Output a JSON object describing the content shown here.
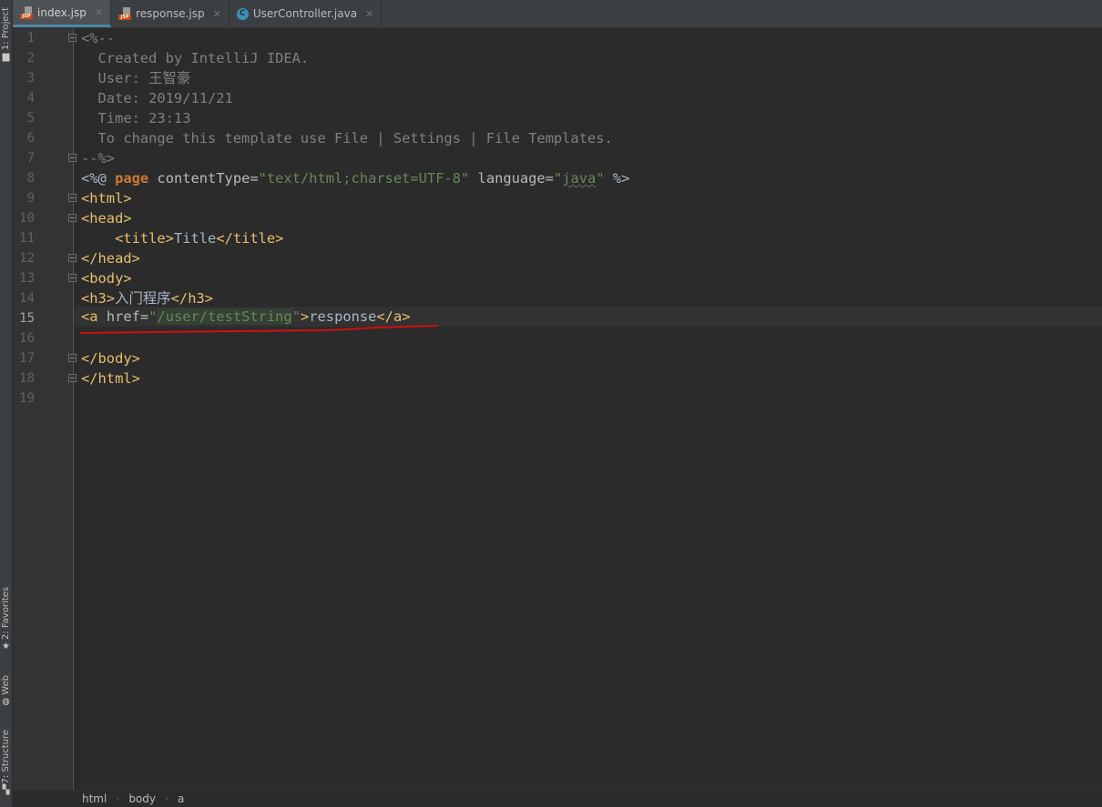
{
  "tool_windows": {
    "project": {
      "label": "1: Project",
      "icon": "folder-icon"
    },
    "favorites": {
      "label": "2: Favorites",
      "icon": "star-icon"
    },
    "web": {
      "label": "Web",
      "icon": "globe-icon"
    },
    "structure": {
      "label": "7: Structure",
      "icon": "structure-icon"
    }
  },
  "tabs": [
    {
      "label": "index.jsp",
      "icon": "jsp-file-icon",
      "badge": "JSP",
      "active": true
    },
    {
      "label": "response.jsp",
      "icon": "jsp-file-icon",
      "badge": "JSP",
      "active": false
    },
    {
      "label": "UserController.java",
      "icon": "java-class-icon",
      "badge": "C",
      "active": false
    }
  ],
  "editor": {
    "current_line": 15,
    "line_numbers": [
      "1",
      "2",
      "3",
      "4",
      "5",
      "6",
      "7",
      "8",
      "9",
      "10",
      "11",
      "12",
      "13",
      "14",
      "15",
      "16",
      "17",
      "18",
      "19"
    ],
    "lines": {
      "l1": "<%--",
      "l2": "  Created by IntelliJ IDEA.",
      "l3": "  User: 王智豪",
      "l4": "  Date: 2019/11/21",
      "l5": "  Time: 23:13",
      "l6": "  To change this template use File | Settings | File Templates.",
      "l7": "--%>",
      "l8": {
        "open": "<%@ ",
        "kw": "page",
        "attr1": " contentType=",
        "val1": "\"text/html;charset=UTF-8\"",
        "attr2": " language=",
        "q1": "\"",
        "val2": "java",
        "q2": "\"",
        "close": " %>"
      },
      "l9": "<html>",
      "l10": "<head>",
      "l11": {
        "indent": "    ",
        "open": "<title>",
        "text": "Title",
        "close": "</title>"
      },
      "l12": "</head>",
      "l13": "<body>",
      "l14": {
        "open": "<h3>",
        "text": "入门程序",
        "close": "</h3>"
      },
      "l15": {
        "open": "<a",
        "attr": " href=",
        "q1": "\"",
        "val": "/user/testString",
        "q2": "\"",
        "gt": ">",
        "text": "response",
        "close": "</a>"
      },
      "l16": "",
      "l17": "</body>",
      "l18": "</html>",
      "l19": ""
    }
  },
  "breadcrumb": [
    "html",
    "body",
    "a"
  ],
  "colors": {
    "background": "#2b2b2b",
    "tag": "#e8bf6a",
    "keyword": "#cc7832",
    "string": "#6a8759",
    "comment": "#808080",
    "annotation_underline": "#d01010",
    "active_tab_accent": "#4a88a6"
  }
}
